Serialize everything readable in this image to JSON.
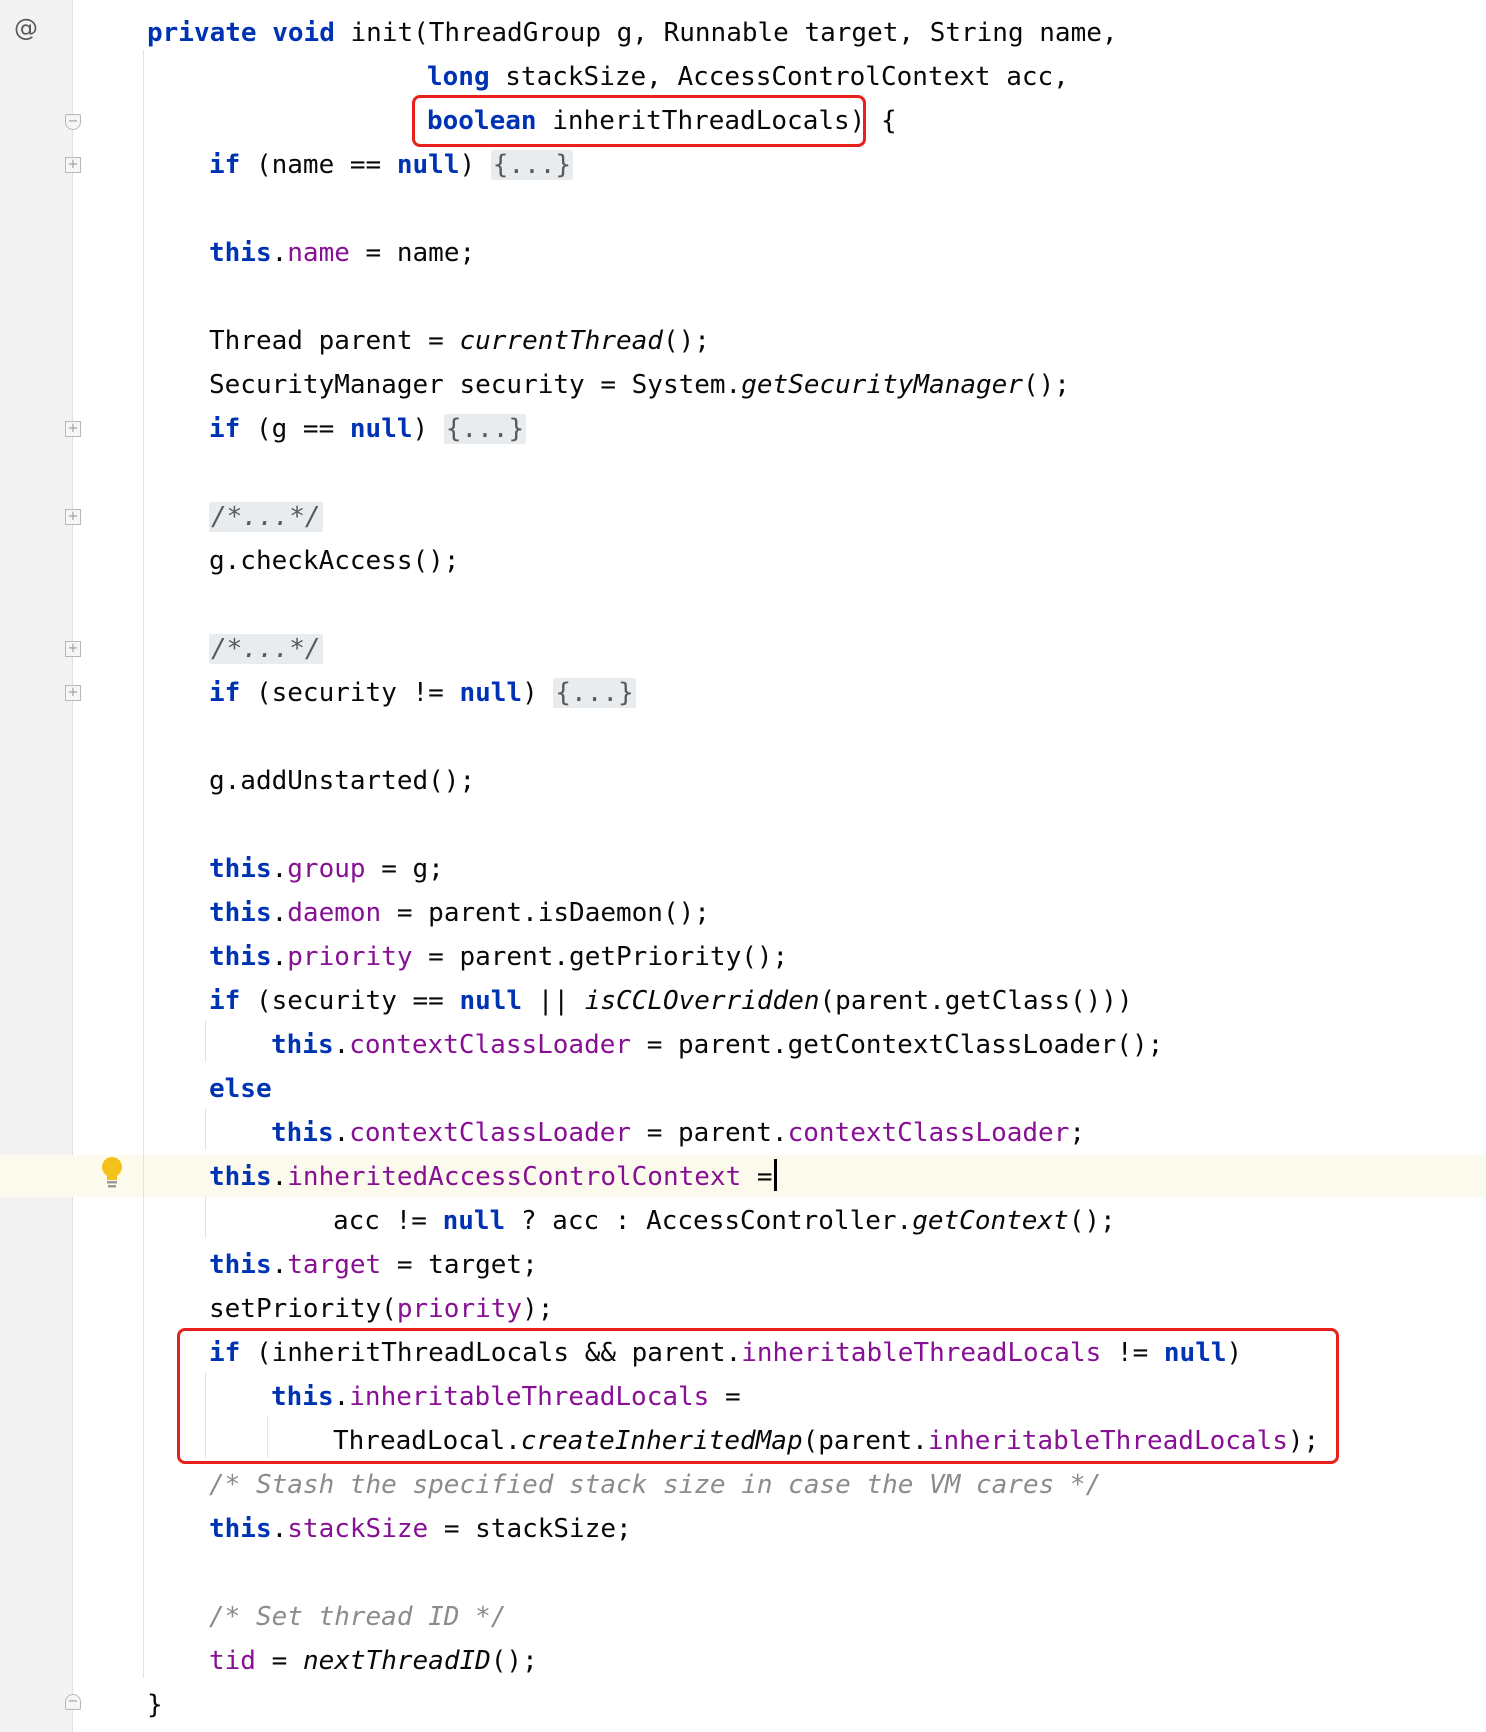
{
  "gutter": {
    "annotation_symbol": "@",
    "fold_expand_glyph": "+",
    "fold_collapse_glyph": "−",
    "intention_icon": "lightbulb-icon"
  },
  "colors": {
    "keyword": "#0033b3",
    "field": "#871094",
    "comment": "#8c8c8c",
    "text": "#080808",
    "highlight_box": "#e8211d",
    "current_line": "#fcfaed"
  },
  "code": {
    "l1": {
      "kw1": "private",
      "kw2": "void",
      "rest": "init(ThreadGroup g, Runnable target, String name,"
    },
    "l2": {
      "kw": "long",
      "rest": "stackSize, AccessControlContext acc,"
    },
    "l3": {
      "kw": "boolean",
      "rest": "inheritThreadLocals)",
      "brace": "{"
    },
    "l4": {
      "kw": "if",
      "pre": "(name ==",
      "null": "null",
      "post": ")",
      "fold": "{...}"
    },
    "l5": {
      "this": "this",
      "dot": ".",
      "field": "name",
      "rest": " = name;"
    },
    "l6": {
      "pre": "Thread parent = ",
      "call": "currentThread",
      "post": "();"
    },
    "l7": {
      "pre": "SecurityManager security = System.",
      "call": "getSecurityManager",
      "post": "();"
    },
    "l8": {
      "kw": "if",
      "pre": "(g ==",
      "null": "null",
      "post": ")",
      "fold": "{...}"
    },
    "l9": {
      "comment": "/*...*/"
    },
    "l10": {
      "text": "g.checkAccess();"
    },
    "l11": {
      "comment": "/*...*/"
    },
    "l12": {
      "kw": "if",
      "pre": "(security !=",
      "null": "null",
      "post": ")",
      "fold": "{...}"
    },
    "l13": {
      "text": "g.addUnstarted();"
    },
    "l14": {
      "this": "this",
      "dot": ".",
      "field": "group",
      "rest": " = g;"
    },
    "l15": {
      "this": "this",
      "dot": ".",
      "field": "daemon",
      "rest": " = parent.isDaemon();"
    },
    "l16": {
      "this": "this",
      "dot": ".",
      "field": "priority",
      "rest": " = parent.getPriority();"
    },
    "l17": {
      "kw": "if",
      "pre": "(security ==",
      "null": "null",
      "mid": " || ",
      "call": "isCCLOverridden",
      "post": "(parent.getClass()))"
    },
    "l18": {
      "this": "this",
      "dot": ".",
      "field": "contextClassLoader",
      "rest": " = parent.getContextClassLoader();"
    },
    "l19": {
      "kw": "else"
    },
    "l20": {
      "this": "this",
      "dot": ".",
      "field": "contextClassLoader",
      "mid": " = parent.",
      "field2": "contextClassLoader",
      "rest": ";"
    },
    "l21": {
      "this": "this",
      "dot": ".",
      "field": "inheritedAccessControlContext",
      "rest": " ="
    },
    "l22": {
      "pre": "acc !=",
      "null": "null",
      "mid": " ? acc : AccessController.",
      "call": "getContext",
      "post": "();"
    },
    "l23": {
      "this": "this",
      "dot": ".",
      "field": "target",
      "rest": " = target;"
    },
    "l24": {
      "pre": "setPriority(",
      "field": "priority",
      "post": ");"
    },
    "l25": {
      "kw": "if",
      "pre": "(inheritThreadLocals && parent.",
      "field": "inheritableThreadLocals",
      "mid": " != ",
      "null": "null",
      "post": ")"
    },
    "l26": {
      "this": "this",
      "dot": ".",
      "field": "inheritableThreadLocals",
      "rest": " ="
    },
    "l27": {
      "pre": "ThreadLocal.",
      "call": "createInheritedMap",
      "mid": "(parent.",
      "field": "inheritableThreadLocals",
      "post": ");"
    },
    "l28": {
      "comment": "/* Stash the specified stack size in case the VM cares */"
    },
    "l29": {
      "this": "this",
      "dot": ".",
      "field": "stackSize",
      "rest": " = stackSize;"
    },
    "l30": {
      "comment": "/* Set thread ID */"
    },
    "l31": {
      "field": "tid",
      "mid": " = ",
      "call": "nextThreadID",
      "post": "();"
    },
    "l32": {
      "brace": "}"
    }
  }
}
